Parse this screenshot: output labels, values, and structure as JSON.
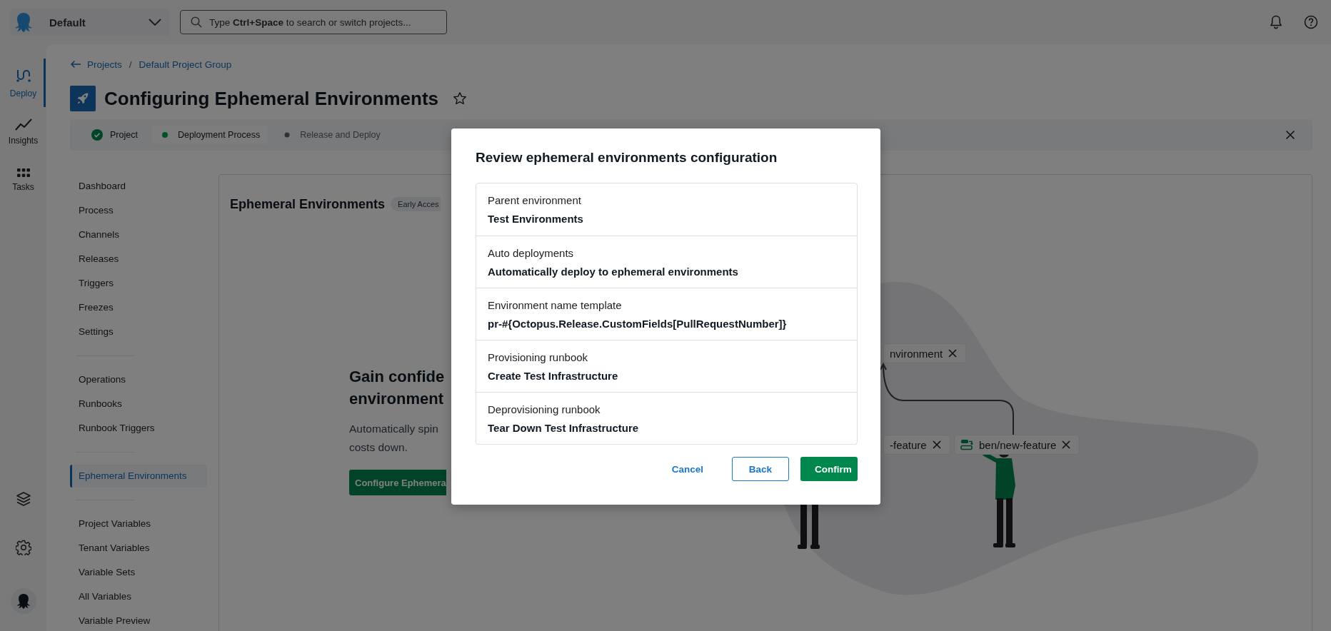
{
  "top_bar": {
    "space_selector": {
      "label": "Default"
    },
    "search": {
      "placeholder": "Type **Ctrl+Space** to search or switch projects..."
    }
  },
  "rail": {
    "items": [
      {
        "label": "Deploy",
        "kind": "deploy",
        "selected": true
      },
      {
        "label": "Insights",
        "kind": "insights",
        "selected": false
      },
      {
        "label": "Tasks",
        "kind": "tasks",
        "selected": false
      }
    ]
  },
  "breadcrumb": {
    "items": [
      "Projects",
      "Default Project Group"
    ],
    "separator": "/"
  },
  "project": {
    "title": "Configuring Ephemeral Environments",
    "favorite": false
  },
  "steps": [
    {
      "label": "Project",
      "kind": "complete"
    },
    {
      "label": "Deployment Process",
      "kind": "current"
    },
    {
      "label": "Release and Deploy",
      "kind": "pending"
    }
  ],
  "nav_groups": [
    [
      {
        "label": "Dashboard",
        "selected": false
      },
      {
        "label": "Process",
        "selected": false
      },
      {
        "label": "Channels",
        "selected": false
      },
      {
        "label": "Releases",
        "selected": false
      },
      {
        "label": "Triggers",
        "selected": false
      },
      {
        "label": "Freezes",
        "selected": false
      },
      {
        "label": "Settings",
        "selected": false
      }
    ],
    [
      {
        "label": "Operations",
        "selected": false
      },
      {
        "label": "Runbooks",
        "selected": false
      },
      {
        "label": "Runbook Triggers",
        "selected": false
      }
    ],
    [
      {
        "label": "Ephemeral Environments",
        "selected": true
      }
    ],
    [
      {
        "label": "Project Variables",
        "selected": false
      },
      {
        "label": "Tenant Variables",
        "selected": false
      },
      {
        "label": "Variable Sets",
        "selected": false
      },
      {
        "label": "All Variables",
        "selected": false
      },
      {
        "label": "Variable Preview",
        "selected": false
      }
    ]
  ],
  "card": {
    "title": "Ephemeral Environments",
    "badge": "Early Acces",
    "hero": {
      "title_lines": [
        "Gain confide",
        "environment"
      ],
      "text_lines": [
        "Automatically spin",
        "costs down."
      ],
      "button": "Configure Ephemera"
    },
    "chips": [
      {
        "label": "nvironment",
        "icon": false
      },
      {
        "label": "-feature",
        "icon": false
      },
      {
        "label": "ben/new-feature",
        "icon": true
      }
    ]
  },
  "modal": {
    "title": "Review ephemeral environments configuration",
    "fields": [
      {
        "label": "Parent environment",
        "value": "Test Environments"
      },
      {
        "label": "Auto deployments",
        "value": "Automatically deploy to ephemeral environments"
      },
      {
        "label": "Environment name template",
        "value": "pr-#{Octopus.Release.CustomFields[PullRequestNumber]}"
      },
      {
        "label": "Provisioning runbook",
        "value": "Create Test Infrastructure"
      },
      {
        "label": "Deprovisioning runbook",
        "value": "Tear Down Test Infrastructure"
      }
    ],
    "buttons": [
      {
        "label": "Cancel",
        "kind": "link"
      },
      {
        "label": "Back",
        "kind": "outline"
      },
      {
        "label": "Confirm",
        "kind": "primary"
      }
    ]
  }
}
